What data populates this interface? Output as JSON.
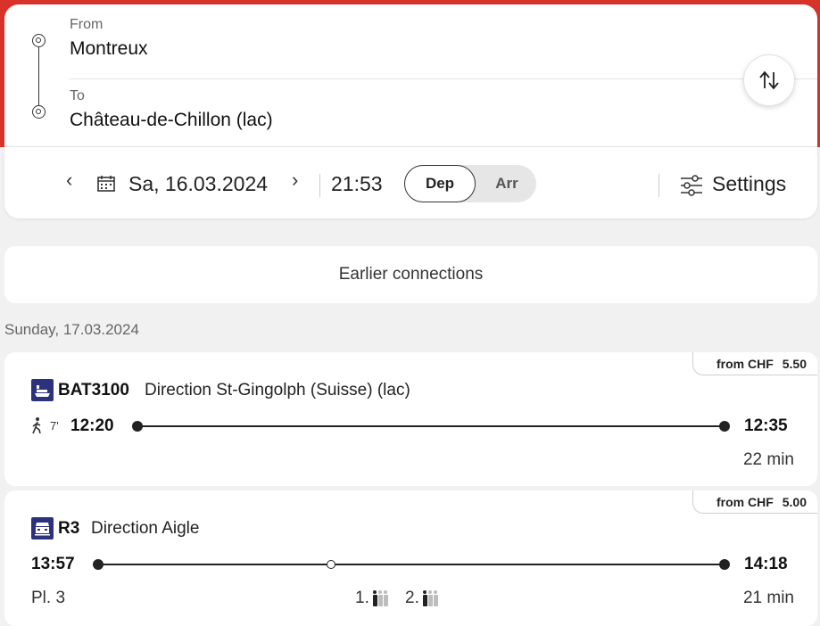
{
  "search": {
    "from_label": "From",
    "from_value": "Montreux",
    "to_label": "To",
    "to_value": "Château-de-Chillon (lac)",
    "swap_icon": "swap-icon",
    "date": "Sa, 16.03.2024",
    "time": "21:53",
    "dep_label": "Dep",
    "arr_label": "Arr",
    "settings_label": "Settings",
    "prev_symbol": "‹",
    "next_symbol": "›"
  },
  "earlier_label": "Earlier connections",
  "day_header": "Sunday, 17.03.2024",
  "connections": [
    {
      "price_prefix": "from CHF",
      "price": "5.50",
      "service_icon": "boat-icon",
      "service": "BAT3100",
      "direction": "Direction St-Gingolph (Suisse) (lac)",
      "walk_minutes": "7'",
      "departure": "12:20",
      "arrival": "12:35",
      "duration": "22 min"
    },
    {
      "price_prefix": "from CHF",
      "price": "5.00",
      "service_icon": "train-icon",
      "service": "R3",
      "direction": "Direction Aigle",
      "departure": "13:57",
      "arrival": "14:18",
      "duration": "21 min",
      "platform": "Pl. 3",
      "occupancy_first_label": "1.",
      "occupancy_second_label": "2.",
      "occupancy_first_level": 1,
      "occupancy_second_level": 1
    }
  ],
  "colors": {
    "brand_red": "#d8322a",
    "service_blue": "#2d327d"
  }
}
